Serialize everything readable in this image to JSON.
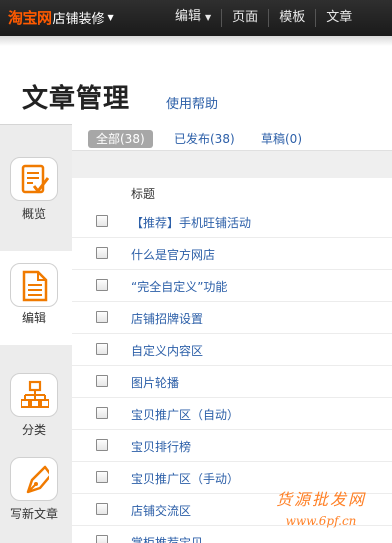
{
  "topbar": {
    "logo": "淘宝网",
    "product": "店铺装修",
    "nav": [
      "编辑",
      "页面",
      "模板",
      "文章"
    ]
  },
  "header": {
    "title": "文章管理",
    "help": "使用帮助"
  },
  "sidebar": {
    "items": [
      {
        "label": "概览",
        "icon": "overview-checklist-icon"
      },
      {
        "label": "编辑",
        "icon": "edit-document-icon"
      },
      {
        "label": "分类",
        "icon": "category-tree-icon"
      },
      {
        "label": "写新文章",
        "icon": "fountain-pen-icon"
      }
    ],
    "active_index": 1
  },
  "tabs": [
    {
      "label": "全部(38)",
      "active": true
    },
    {
      "label": "已发布(38)",
      "active": false
    },
    {
      "label": "草稿(0)",
      "active": false
    }
  ],
  "table": {
    "header": "标题",
    "rows": [
      "【推荐】手机旺铺活动",
      "什么是官方网店",
      "“完全自定义”功能",
      "店铺招牌设置",
      "自定义内容区",
      "图片轮播",
      "宝贝推广区（自动）",
      "宝贝排行榜",
      "宝贝推广区（手动）",
      "店铺交流区",
      "掌柜推荐宝贝"
    ]
  },
  "watermark": {
    "line1": "货源批发网",
    "line2": "www.6pf.cn"
  },
  "colors": {
    "brand_orange": "#ff5a00",
    "link_blue": "#2c5fa8",
    "icon_orange": "#f07a00"
  }
}
